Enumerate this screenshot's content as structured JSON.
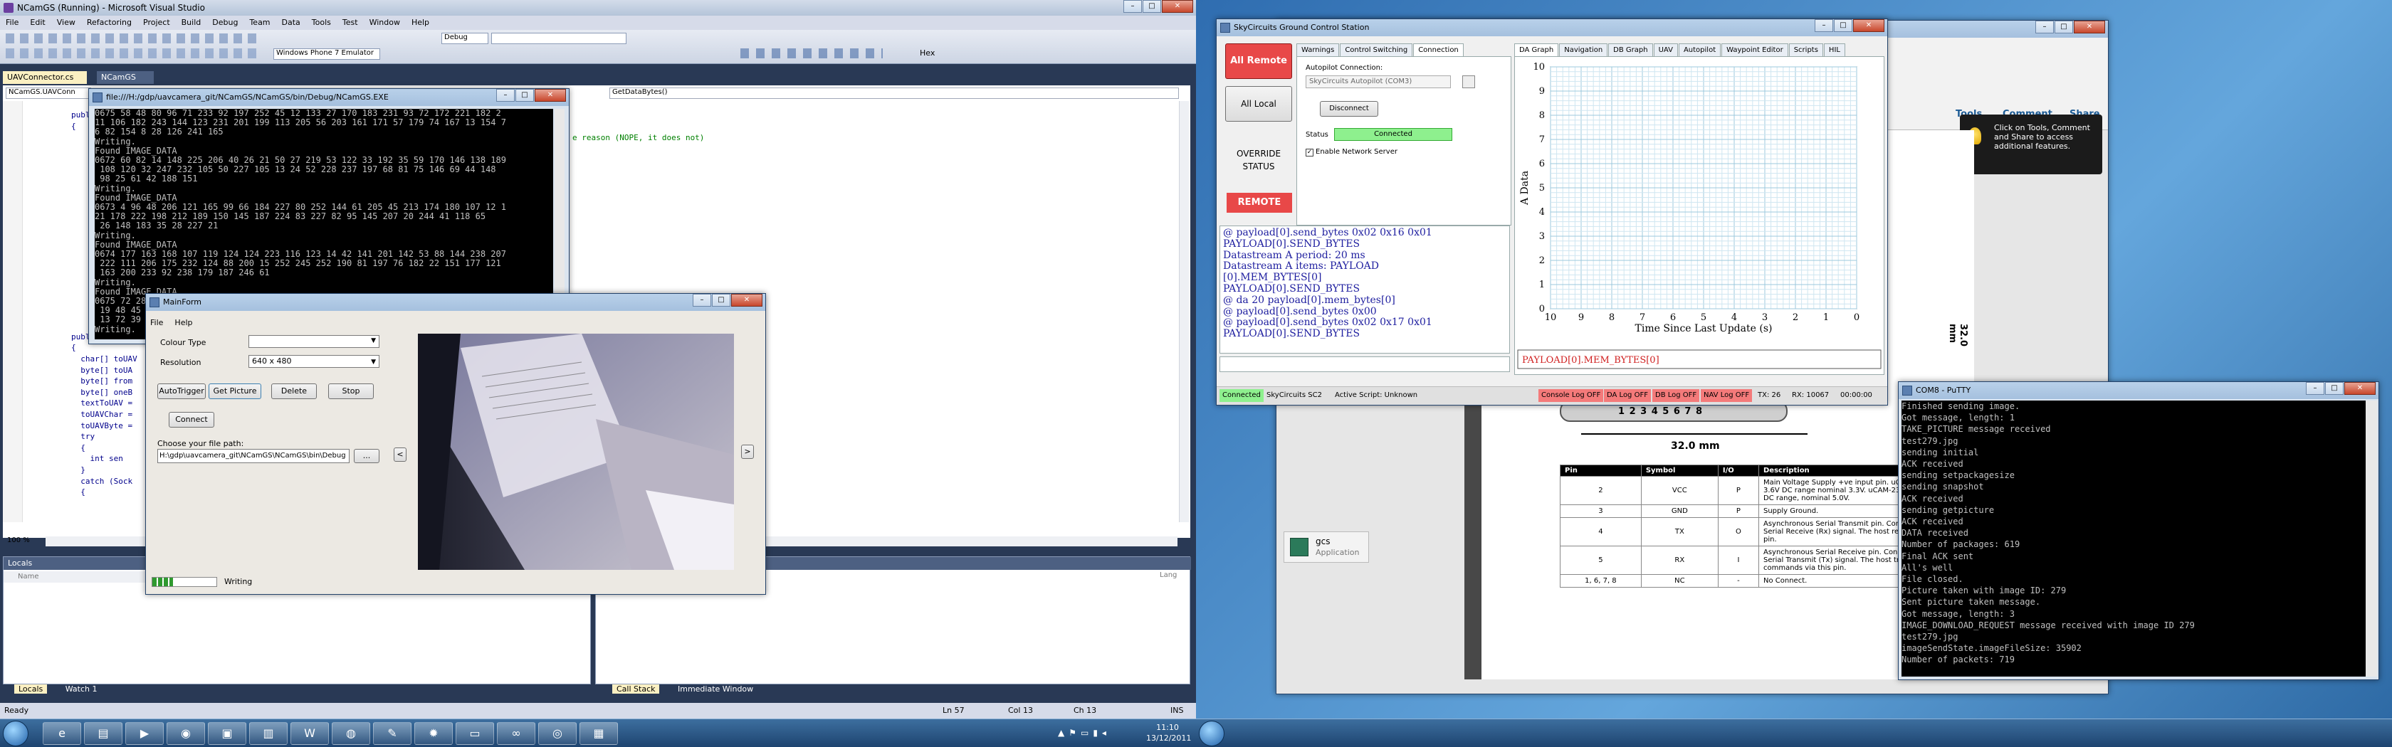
{
  "vs": {
    "title": "NCamGS (Running) - Microsoft Visual Studio",
    "menu": [
      "File",
      "Edit",
      "View",
      "Refactoring",
      "Project",
      "Build",
      "Debug",
      "Team",
      "Data",
      "Tools",
      "Test",
      "Window",
      "Help"
    ],
    "toolbar_combo1": "Debug",
    "toolbar_combo2": "Windows Phone 7 Emulator",
    "toolbar_hex": "Hex",
    "doc_tabs": [
      "UAVConnector.cs",
      "NCamGS"
    ],
    "member_combo": "GetDataBytes()",
    "class_combo": "NCamGS.UAVConn",
    "code_comment": "e reason (NOPE, it does not)",
    "code_lines": [
      "public",
      "{",
      "",
      "",
      "",
      "",
      "",
      "",
      "",
      "",
      "",
      "",
      "",
      "",
      "",
      "",
      "",
      "",
      "",
      "",
      "public void Sen",
      "{",
      "  char[] toUAV",
      "  byte[] toUA",
      "  byte[] from",
      "  byte[] oneB",
      "  textToUAV =",
      "  toUAVChar =",
      "  toUAVByte =",
      "  try",
      "  {",
      "    int sen",
      "  }",
      "  catch (Sock",
      "  {"
    ],
    "zoom": "100 %",
    "locals_title": "Locals",
    "locals_cols": [
      "Name",
      "Lang"
    ],
    "bottom_tabs": [
      "Locals",
      "Watch 1"
    ],
    "bottom_tabs2": [
      "Call Stack",
      "Immediate Window"
    ],
    "status": {
      "ready": "Ready",
      "ln": "Ln 57",
      "col": "Col 13",
      "ch": "Ch 13",
      "ins": "INS"
    }
  },
  "console_win": {
    "title": "file:///H:/gdp/uavcamera_git/NCamGS/NCamGS/bin/Debug/NCamGS.EXE",
    "lines": [
      "0675 58 48 80 96 71 233 92 197 252 45 12 133 27 170 183 231 93 72 172 221 182 2",
      "11 106 182 243 144 123 231 201 199 113 205 56 203 161 171 57 179 74 167 13 154 7",
      "6 82 154 8 28 126 241 165",
      "Writing.",
      "Found IMAGE_DATA",
      "0672 60 82 14 148 225 206 40 26 21 50 27 219 53 122 33 192 35 59 170 146 138 189",
      " 108 120 32 247 232 105 50 227 105 13 24 52 228 237 197 68 81 75 146 69 44 148",
      " 98 25 61 42 188 151",
      "Writing.",
      "Found IMAGE_DATA",
      "0673 4 96 48 206 121 165 99 66 184 227 80 252 144 61 205 45 213 174 180 107 12 1",
      "21 178 222 198 212 189 150 145 187 224 83 227 82 95 145 207 20 244 41 118 65",
      " 26 148 183 35 28 227 21",
      "Writing.",
      "Found IMAGE_DATA",
      "0674 177 163 168 107 119 124 124 223 116 123 14 42 141 201 142 53 88 144 238 207",
      " 222 111 206 175 232 124 88 200 15 252 245 252 190 81 197 76 182 22 151 177 121",
      " 163 200 233 92 238 179 187 246 61",
      "Writing.",
      "Found IMAGE_DATA",
      "0675 72 28 225 46 20 202 184 254 19 146 13 117 44 45 24 239 89 62 38 135 58 116",
      " 19 48 45 138 52 186 145 100 173 147 53 11 165 216 76 212 62 18 138 150 77 192",
      " 13 72 39 37 37 31 154 21 149 11 241 145 77 182 116 85 166 12 37 173 165 183 22",
      "Writing."
    ]
  },
  "mainform": {
    "title": "MainForm",
    "menu": [
      "File",
      "Help"
    ],
    "colour_label": "Colour Type",
    "colour_value": "",
    "resolution_label": "Resolution",
    "resolution_value": "640 x 480",
    "buttons": [
      "AutoTrigger",
      "Get Picture",
      "Delete",
      "Stop"
    ],
    "connect": "Connect",
    "path_label": "Choose your file path:",
    "path_value": "H:\\gdp\\uavcamera_git\\NCamGS\\NCamGS\\bin\\Debug",
    "browse": "...",
    "prev": "<",
    "next": ">",
    "progress": 0.32,
    "status": "Writing"
  },
  "gcs": {
    "title": "SkyCircuits Ground Control Station",
    "all_remote": "All Remote",
    "all_local": "All Local",
    "override": "OVERRIDE STATUS",
    "remote": "REMOTE",
    "tabs": [
      "Warnings",
      "Control Switching",
      "Connection"
    ],
    "ap_label": "Autopilot Connection:",
    "ap_value": "SkyCircuits Autopilot (COM3)",
    "disconnect": "Disconnect",
    "status_label": "Status",
    "status_value": "Connected",
    "enable_server": "Enable Network Server",
    "log": [
      "@ payload[0].send_bytes 0x02 0x16 0x01",
      "PAYLOAD[0].SEND_BYTES",
      "Datastream A period: 20 ms",
      "Datastream A items: PAYLOAD",
      "[0].MEM_BYTES[0]",
      "PAYLOAD[0].SEND_BYTES",
      "@ da 20 payload[0].mem_bytes[0]",
      "@ payload[0].send_bytes 0x00",
      "@ payload[0].send_bytes 0x02 0x17 0x01",
      "PAYLOAD[0].SEND_BYTES"
    ],
    "graph_tabs": [
      "DA Graph",
      "Navigation",
      "DB Graph",
      "UAV",
      "Autopilot",
      "Waypoint Editor",
      "Scripts",
      "HIL"
    ],
    "graph_series": "PAYLOAD[0].MEM_BYTES[0]",
    "status_bar": [
      "Connected",
      "SkyCircuits SC2",
      "Active Script: Unknown",
      "Console Log OFF",
      "DA Log OFF",
      "DB Log OFF",
      "NAV Log OFF",
      "TX: 26",
      "RX: 10067",
      "00:00:00"
    ]
  },
  "chart_data": {
    "type": "line",
    "title": "",
    "xlabel": "Time Since Last Update (s)",
    "ylabel": "A Data",
    "xlim": [
      10,
      0
    ],
    "ylim": [
      0,
      10
    ],
    "xticks": [
      10,
      9,
      8,
      7,
      6,
      5,
      4,
      3,
      2,
      1,
      0
    ],
    "yticks": [
      0,
      1,
      2,
      3,
      4,
      5,
      6,
      7,
      8,
      9,
      10
    ],
    "grid": true,
    "series": [
      {
        "name": "PAYLOAD[0].MEM_BYTES[0]",
        "x": [],
        "y": []
      }
    ]
  },
  "pdf": {
    "toolbar": [
      "Tools",
      "Comment",
      "Share"
    ],
    "tooltip": "Click on Tools, Comment and Share to access additional features.",
    "dim": "32.0 mm",
    "dim_v": "32.0 mm",
    "pins": "1 2 3 4 5 6 7 8",
    "table_head": [
      "Pin",
      "Symbol",
      "I/O",
      "Description"
    ],
    "rows": [
      {
        "pin": "2",
        "sym": "VCC",
        "io": "P",
        "desc": "Main Voltage Supply +ve input pin. uCAM-TTL : 3.0V to 3.6V DC range nominal 3.3V. uCAM-232 : 4.5V to 5.5V DC range, nominal 5.0V."
      },
      {
        "pin": "3",
        "sym": "GND",
        "io": "P",
        "desc": "Supply Ground."
      },
      {
        "pin": "4",
        "sym": "TX",
        "io": "O",
        "desc": "Asynchronous Serial Transmit pin. Connect this pin to Serial Receive (Rx) signal. The host receives data from pin."
      },
      {
        "pin": "5",
        "sym": "RX",
        "io": "I",
        "desc": "Asynchronous Serial Receive pin. Connect this pin to Serial Transmit (Tx) signal. The host transmits commands via this pin."
      },
      {
        "pin": "1, 6, 7, 8",
        "sym": "NC",
        "io": "-",
        "desc": "No Connect."
      }
    ],
    "taskapp": "gcs",
    "taskapp_sub": "Application"
  },
  "putty": {
    "title": "COM8 - PuTTY",
    "lines": [
      "Finished sending image.",
      "Got message, length: 1",
      "TAKE_PICTURE message received",
      "test279.jpg",
      "sending initial",
      "ACK received",
      "sending setpackagesize",
      "sending snapshot",
      "ACK received",
      "sending getpicture",
      "ACK received",
      "DATA received",
      "Number of packages: 619",
      "Final ACK sent",
      "All's well",
      "File closed.",
      "Picture taken with image ID: 279",
      "Sent picture taken message.",
      "Got message, length: 3",
      "IMAGE_DOWNLOAD_REQUEST message received with image ID 279",
      "test279.jpg",
      "imageSendState.imageFileSize: 35902",
      "Number of packets: 719",
      ""
    ]
  },
  "clock": {
    "time": "11:10",
    "date": "13/12/2011"
  }
}
